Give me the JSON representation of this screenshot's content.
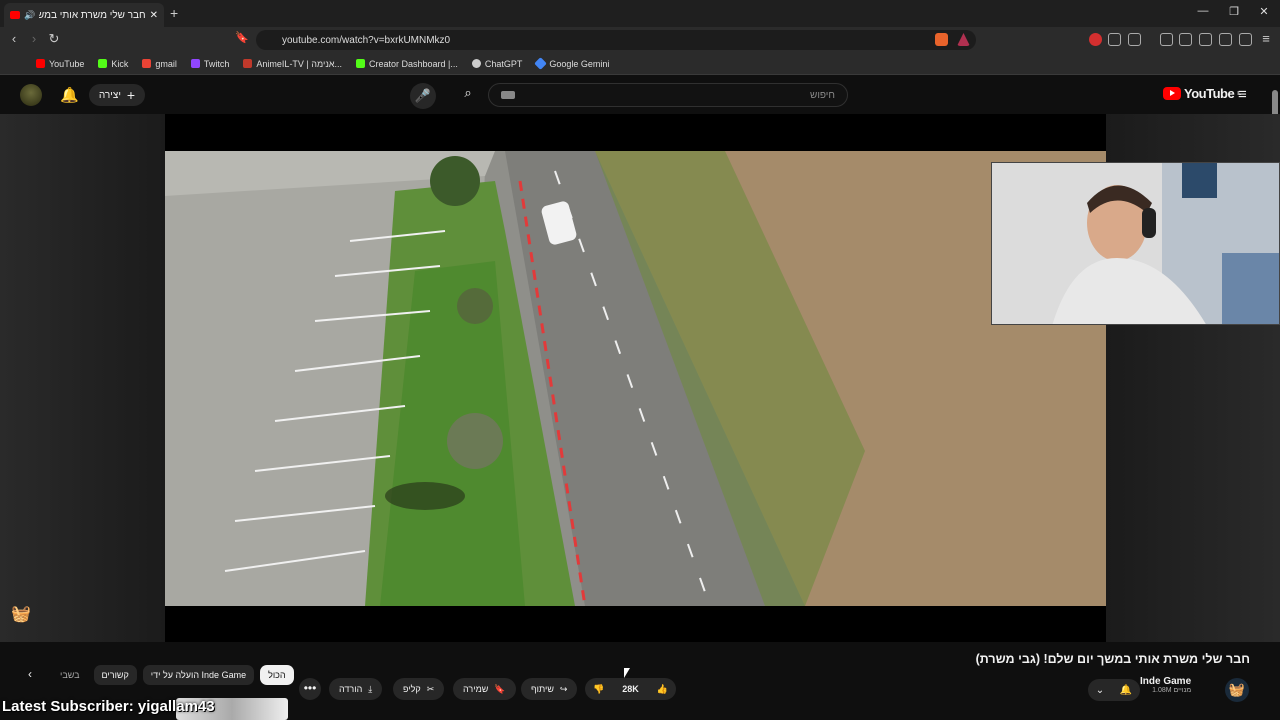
{
  "browser": {
    "tab_title": "חבר שלי משרת אותי במשך יו",
    "new_tab": "+",
    "url": "youtube.com/watch?v=bxrkUMNMkz0",
    "window": {
      "min": "—",
      "max": "❐",
      "close": "✕"
    },
    "bookmarks": [
      {
        "label": "YouTube",
        "color": "#ff0000"
      },
      {
        "label": "Kick",
        "color": "#53fc18"
      },
      {
        "label": "gmail",
        "color": "#ea4335"
      },
      {
        "label": "Twitch",
        "color": "#9146ff"
      },
      {
        "label": "AnimeIL-TV | אנימה...",
        "color": "#c0392b"
      },
      {
        "label": "Creator Dashboard |...",
        "color": "#53fc18"
      },
      {
        "label": "ChatGPT",
        "color": "#cccccc"
      },
      {
        "label": "Google Gemini",
        "color": "#4285f4"
      }
    ]
  },
  "youtube": {
    "create_label": "יצירה",
    "search_placeholder": "חיפוש",
    "logo_text": "YouTube",
    "logo_sup": "IL"
  },
  "video": {
    "title": "חבר שלי משרת אותי במשך יום שלם! (גבי משרת)",
    "channel_name": "Inde Game",
    "subscribers": "1.08M מנויים",
    "likes": "28K"
  },
  "actions": {
    "share": "שיתוף",
    "save": "שמירה",
    "clip": "קליפ",
    "download": "הורדה",
    "more": "•••"
  },
  "chips": {
    "all": "הכול",
    "uploaded_by": "הועלה על ידי Inde Game",
    "related": "קשורים",
    "recent": "בשבי"
  },
  "overlay": {
    "latest_subscriber": "Latest Subscriber: yigallam43"
  }
}
